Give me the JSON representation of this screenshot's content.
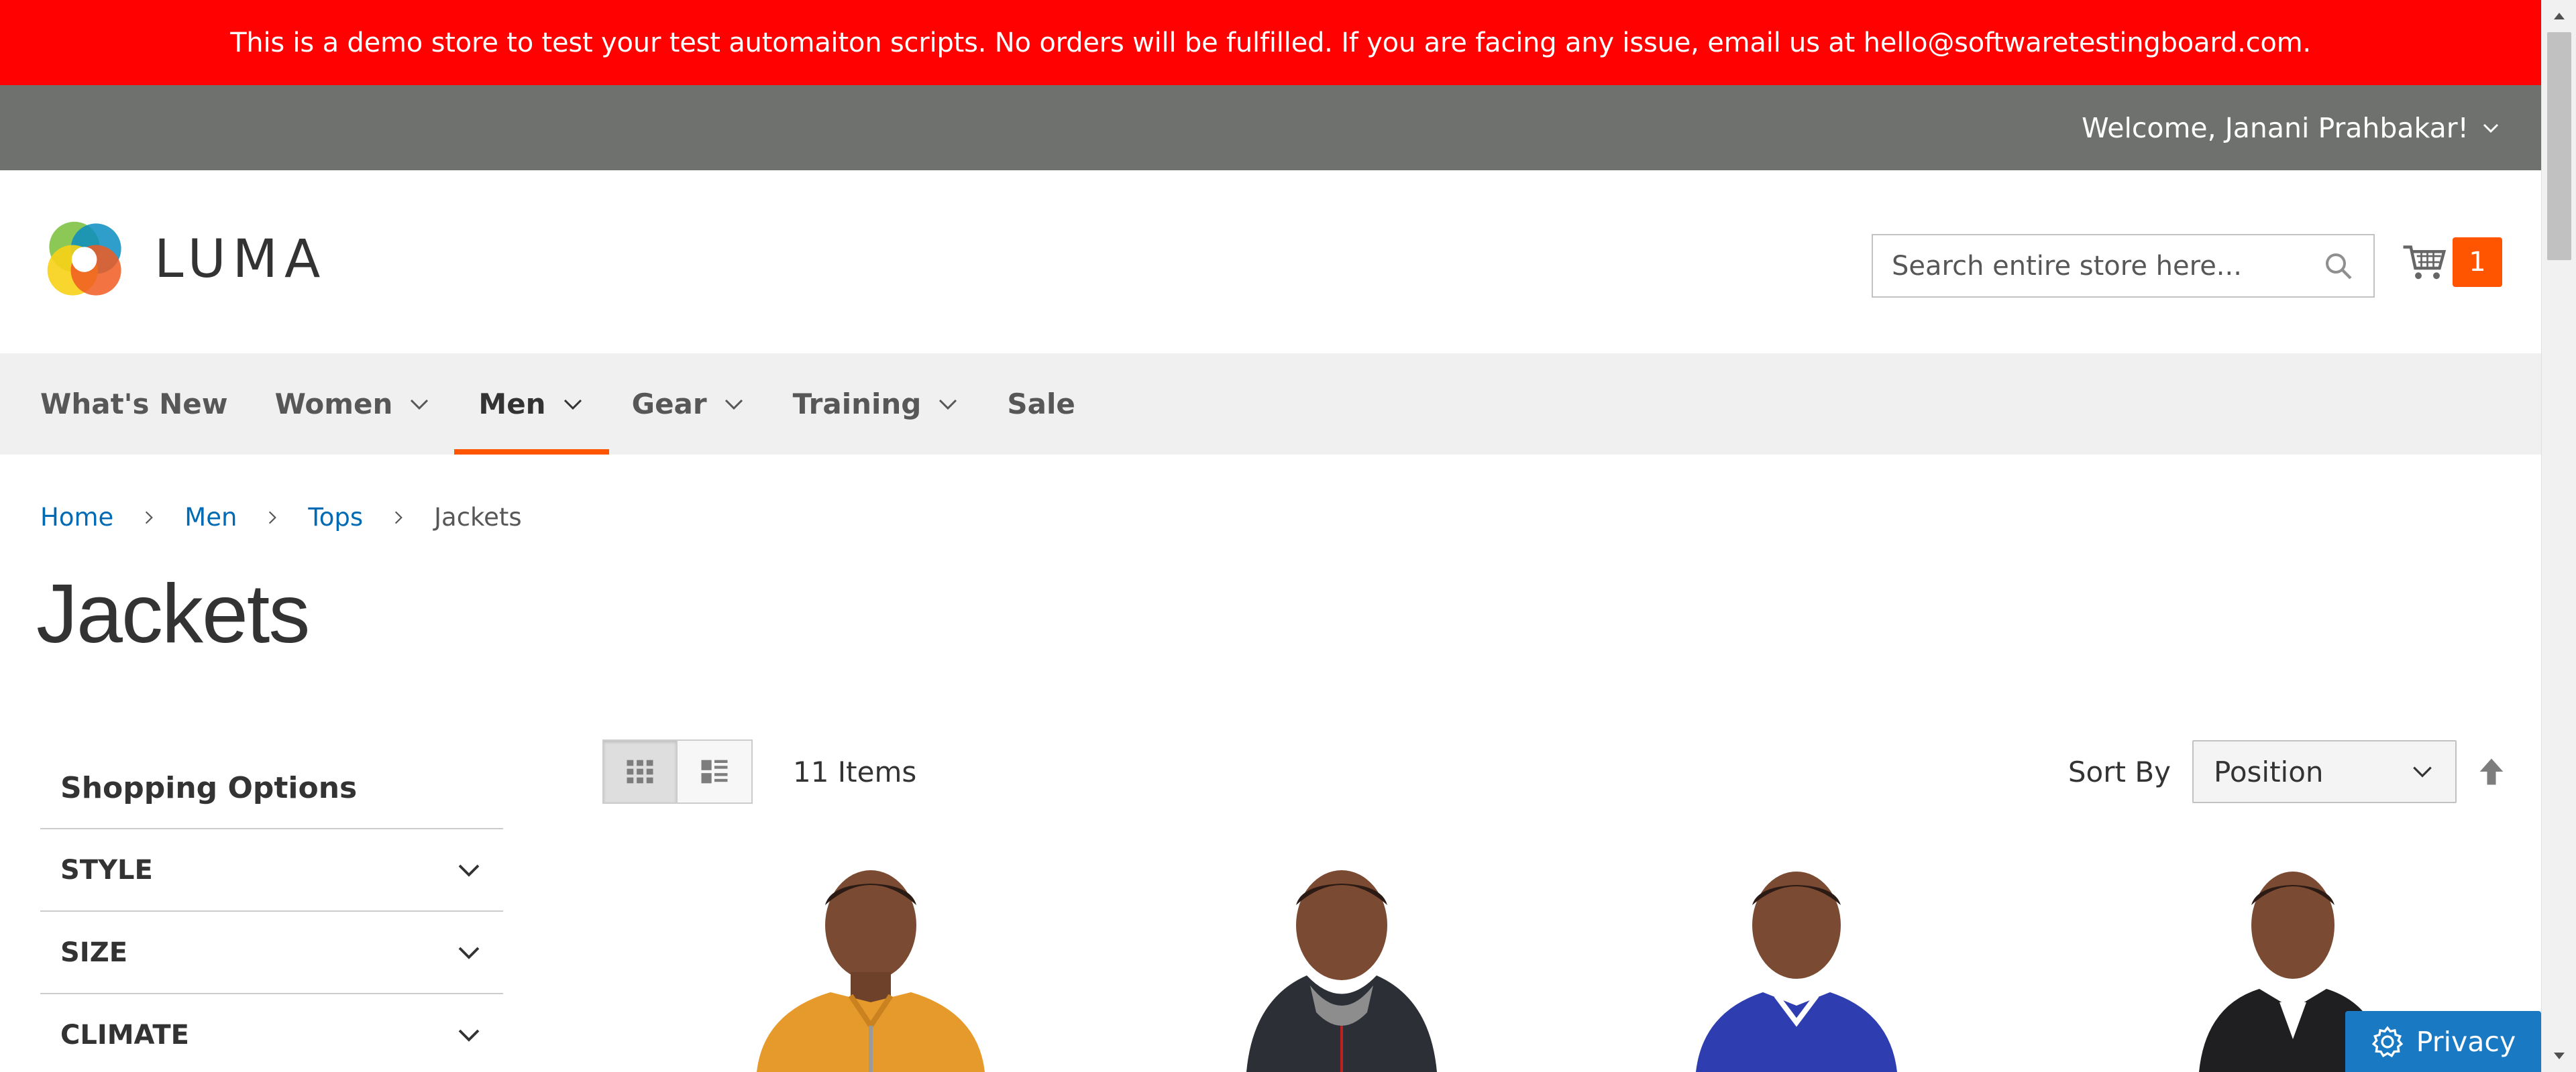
{
  "notice": {
    "text": "This is a demo store to test your test automaiton scripts. No orders will be fulfilled. If you are facing any issue, email us at hello@softwaretestingboard.com."
  },
  "panel": {
    "welcome": "Welcome, Janani Prahbakar!"
  },
  "header": {
    "logo_text": "LUMA",
    "search_placeholder": "Search entire store here...",
    "cart_count": "1"
  },
  "nav": {
    "items": [
      {
        "label": "What's New"
      },
      {
        "label": "Women"
      },
      {
        "label": "Men"
      },
      {
        "label": "Gear"
      },
      {
        "label": "Training"
      },
      {
        "label": "Sale"
      }
    ]
  },
  "breadcrumb": [
    "Home",
    "Men",
    "Tops",
    "Jackets"
  ],
  "page_title": "Jackets",
  "sidebar": {
    "title": "Shopping Options",
    "filters": [
      "STYLE",
      "SIZE",
      "CLIMATE"
    ]
  },
  "toolbar": {
    "amount": "11 Items",
    "sort_label": "Sort By",
    "sort_value": "Position"
  },
  "privacy": {
    "label": "Privacy"
  },
  "colors": {
    "notice_bg": "#ff0101",
    "panel_bg": "#6e716e",
    "accent": "#ff5501",
    "link": "#006bb4",
    "privacy_bg": "#1979c3"
  }
}
